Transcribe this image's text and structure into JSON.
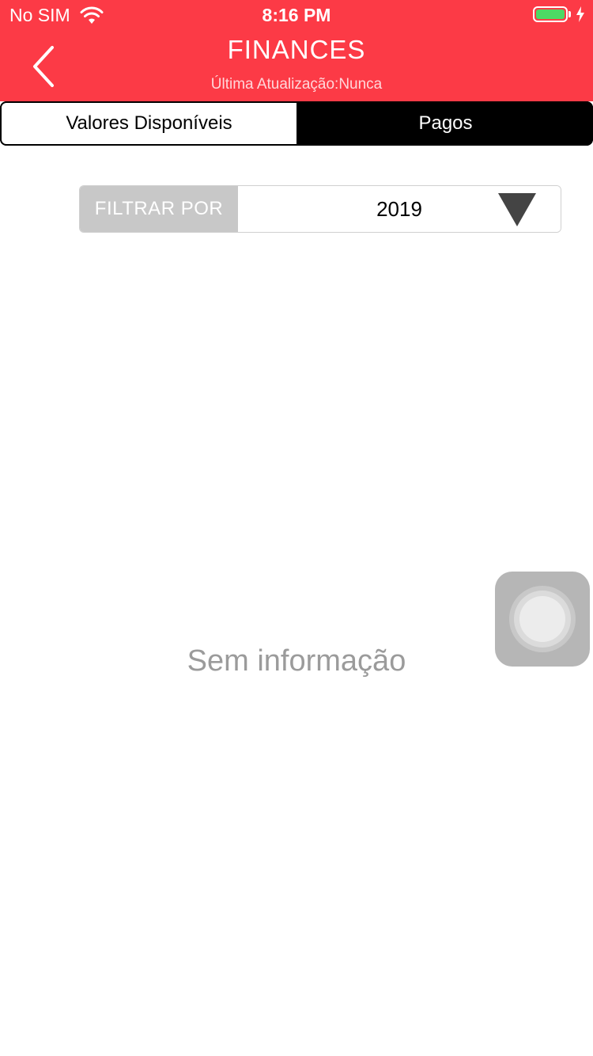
{
  "status_bar": {
    "carrier": "No SIM",
    "time": "8:16 PM",
    "battery_color": "#4cd964"
  },
  "header": {
    "title": "FINANCES",
    "subtitle": "Última Atualização:Nunca",
    "background_color": "#fc3a46",
    "back_icon": "chevron-left-icon"
  },
  "tabs": [
    {
      "label": "Valores Disponíveis",
      "active": true
    },
    {
      "label": "Pagos",
      "active": false
    }
  ],
  "filter": {
    "label": "FILTRAR POR",
    "selected_value": "2019",
    "dropdown_icon": "triangle-down-icon"
  },
  "empty_state": {
    "message": "Sem informação"
  },
  "assistive_touch": {
    "icon": "assistive-touch-icon"
  }
}
